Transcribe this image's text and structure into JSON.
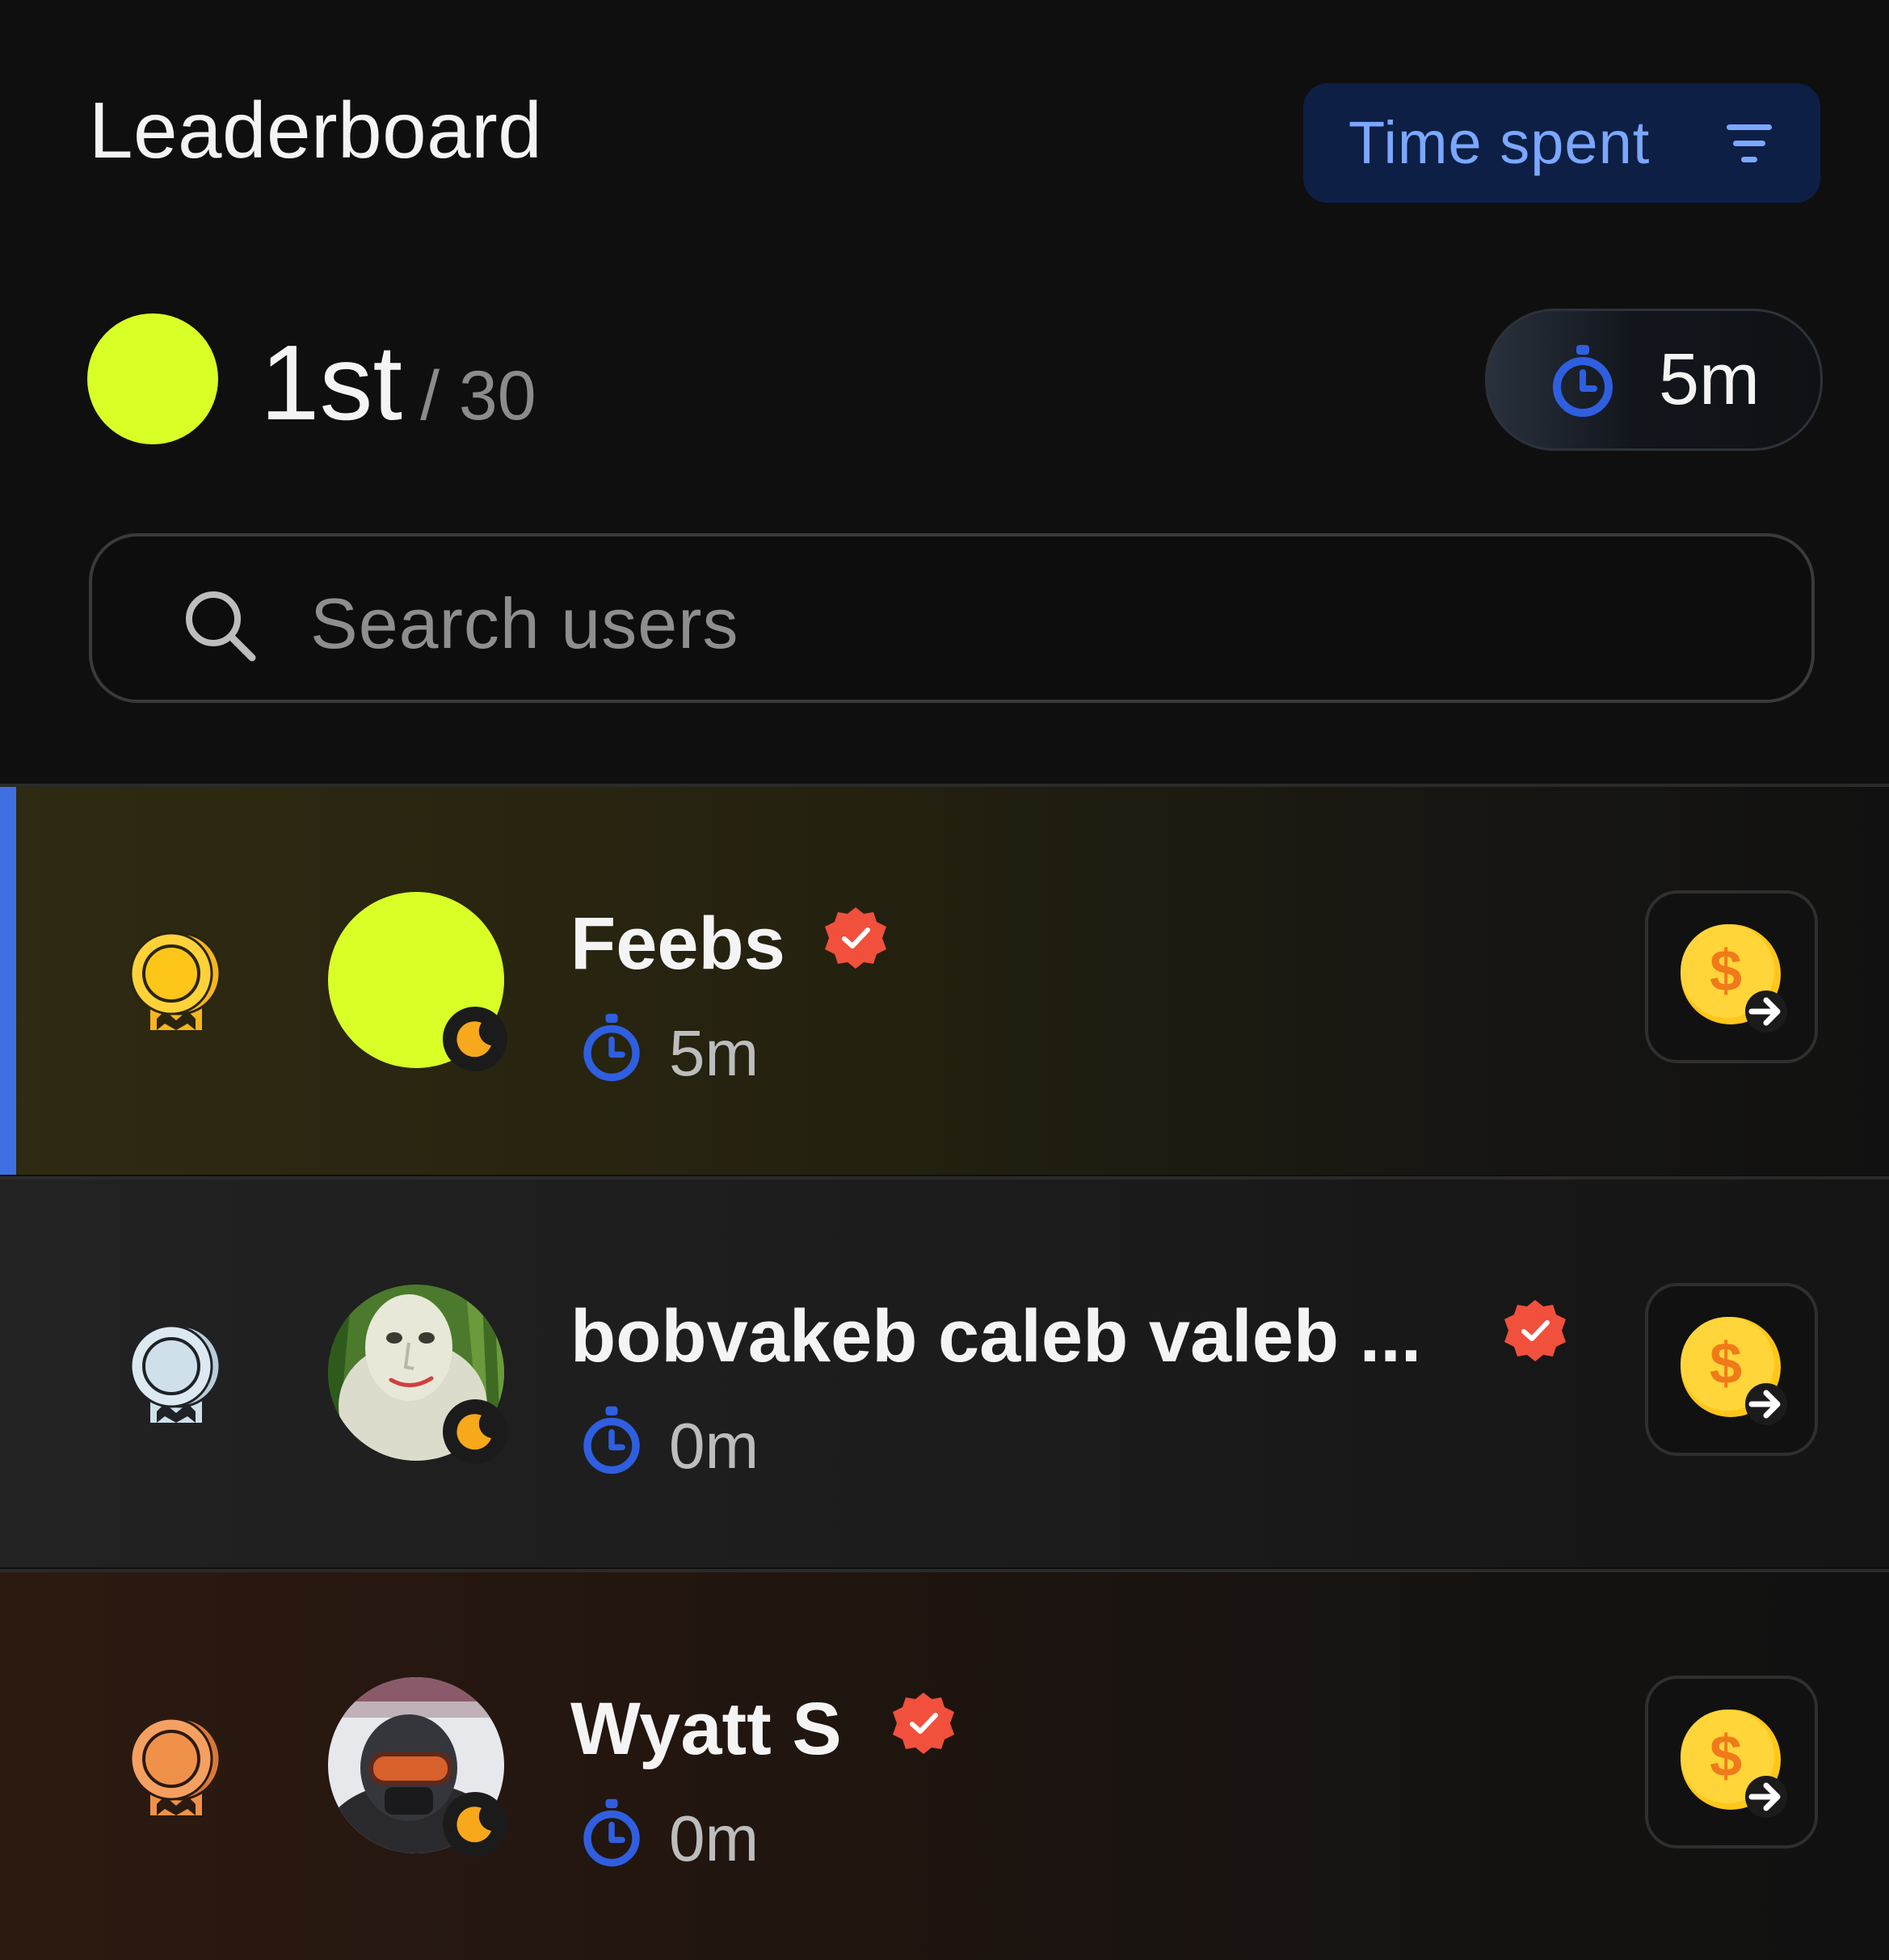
{
  "header": {
    "title": "Leaderboard",
    "filter_label": "Time spent",
    "filter_icon": "filter-lines-icon"
  },
  "me": {
    "place": "1st",
    "total": "/ 30",
    "time": "5m",
    "avatar_color": "#d8ff26"
  },
  "search": {
    "placeholder": "Search users"
  },
  "users": [
    {
      "rank": 1,
      "medal": "gold",
      "name": "Feebs",
      "time": "5m",
      "verified": true
    },
    {
      "rank": 2,
      "medal": "silver",
      "name": "bobvakeb caleb valeb ...",
      "time": "0m",
      "verified": true
    },
    {
      "rank": 3,
      "medal": "bronze",
      "name": "Wyatt S",
      "time": "0m",
      "verified": true
    }
  ],
  "colors": {
    "accent_blue": "#3f6fe0",
    "filter_text": "#7ba7ff",
    "stopwatch": "#2f5fe0",
    "verified": "#f0503c",
    "coin": "#ffc61a",
    "gold": "#f7b51f",
    "silver": "#cfe0ea",
    "bronze": "#f0914a"
  }
}
